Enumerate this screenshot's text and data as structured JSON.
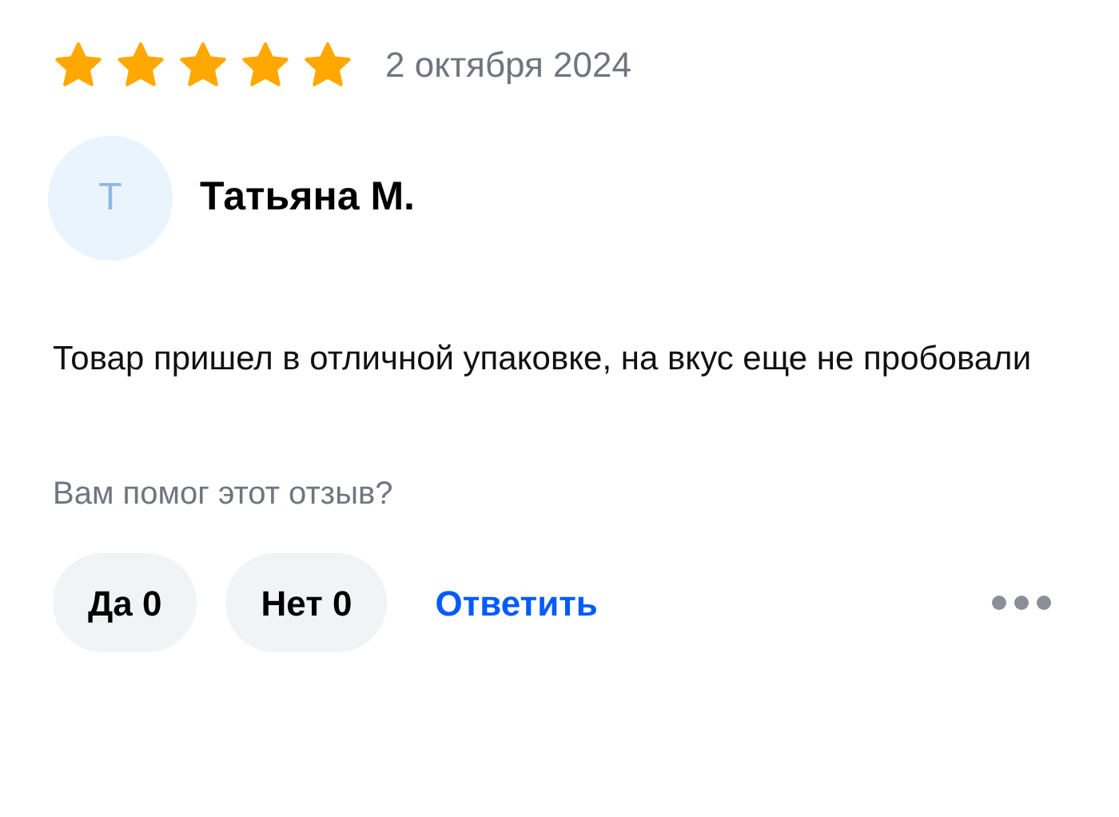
{
  "review": {
    "stars": 5,
    "date": "2 октября 2024",
    "author": {
      "initial": "Т",
      "name": "Татьяна М."
    },
    "text": "Товар пришел в отличной упаковке, на вкус еще не пробовали",
    "helpful_question": "Вам помог этот отзыв?",
    "votes": [
      {
        "label": "Да 0"
      },
      {
        "label": "Нет 0"
      }
    ],
    "reply_link": "Ответить"
  }
}
